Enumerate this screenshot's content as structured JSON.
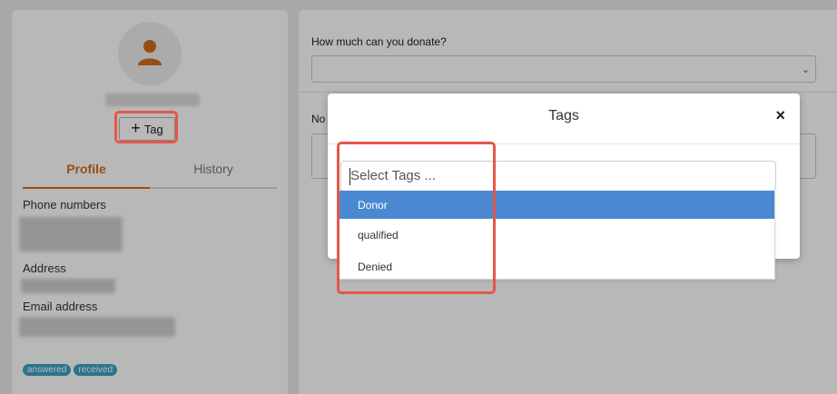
{
  "profile": {
    "tag_button_label": "Tag",
    "tabs": [
      {
        "label": "Profile",
        "active": true
      },
      {
        "label": "History",
        "active": false
      }
    ],
    "fields": {
      "phone_label": "Phone numbers",
      "address_label": "Address",
      "email_label": "Email address"
    },
    "chips": [
      "answered",
      "received"
    ]
  },
  "form": {
    "donate_label": "How much can you donate?",
    "notes_label": "No"
  },
  "modal": {
    "title": "Tags",
    "close_symbol": "×",
    "search_placeholder": "Select Tags ...",
    "options": [
      {
        "label": "Donor",
        "highlighted": true
      },
      {
        "label": "qualified",
        "highlighted": false
      },
      {
        "label": "Denied",
        "highlighted": false
      }
    ]
  },
  "colors": {
    "accent_orange": "#d36b1c",
    "highlight_blue": "#4a89d2",
    "annotation_red": "#e4574a",
    "chip_teal": "#3aa2c3"
  },
  "icons": {
    "avatar": "user-icon",
    "plus": "plus-icon",
    "close": "close-icon",
    "select_caret": "chevron-down-icon"
  }
}
